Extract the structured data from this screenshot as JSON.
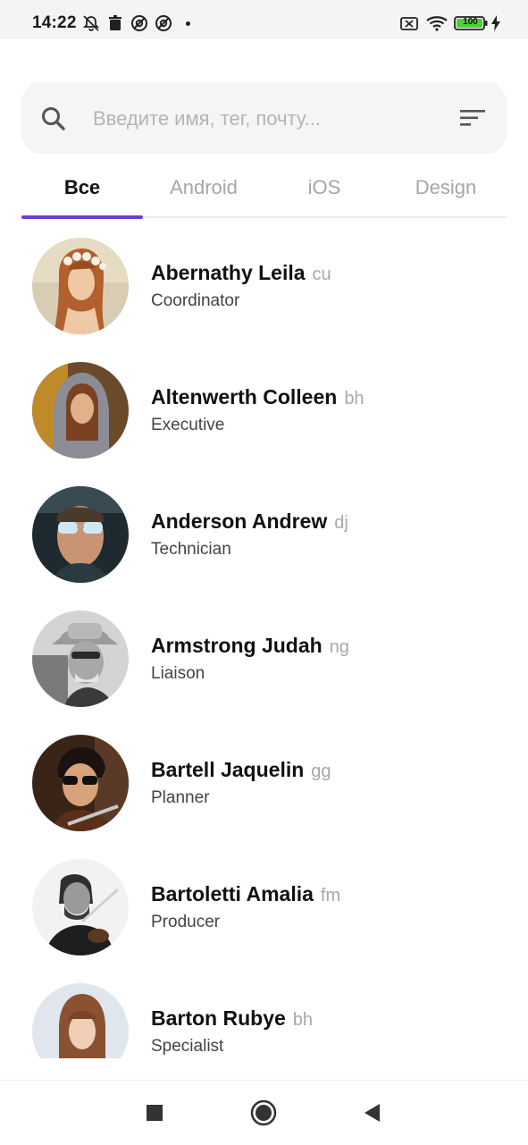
{
  "status_bar": {
    "time": "14:22",
    "battery_level": "100",
    "icons": [
      "bell-off-icon",
      "trash-icon",
      "at-sign-icon",
      "at-sign-icon",
      "dot-icon",
      "sim-off-icon",
      "wifi-icon",
      "battery-icon",
      "charging-icon"
    ]
  },
  "search": {
    "placeholder": "Введите имя, тег, почту...",
    "value": "",
    "search_icon": "search-icon",
    "filter_icon": "filter-icon"
  },
  "tabs": [
    {
      "label": "Все",
      "active": true
    },
    {
      "label": "Android",
      "active": false
    },
    {
      "label": "iOS",
      "active": false
    },
    {
      "label": "Design",
      "active": false
    }
  ],
  "contacts": [
    {
      "name": "Abernathy Leila",
      "tag": "cu",
      "role": "Coordinator"
    },
    {
      "name": "Altenwerth Colleen",
      "tag": "bh",
      "role": "Executive"
    },
    {
      "name": "Anderson Andrew",
      "tag": "dj",
      "role": "Technician"
    },
    {
      "name": "Armstrong Judah",
      "tag": "ng",
      "role": "Liaison"
    },
    {
      "name": "Bartell Jaquelin",
      "tag": "gg",
      "role": "Planner"
    },
    {
      "name": "Bartoletti Amalia",
      "tag": "fm",
      "role": "Producer"
    },
    {
      "name": "Barton Rubye",
      "tag": "bh",
      "role": "Specialist"
    }
  ],
  "nav_bar": {
    "buttons": [
      "recents-square-icon",
      "home-circle-icon",
      "back-triangle-icon"
    ]
  },
  "colors": {
    "accent": "#6b3fd6",
    "search_bg": "#f5f5f5",
    "muted_text": "#a8a8a8"
  }
}
